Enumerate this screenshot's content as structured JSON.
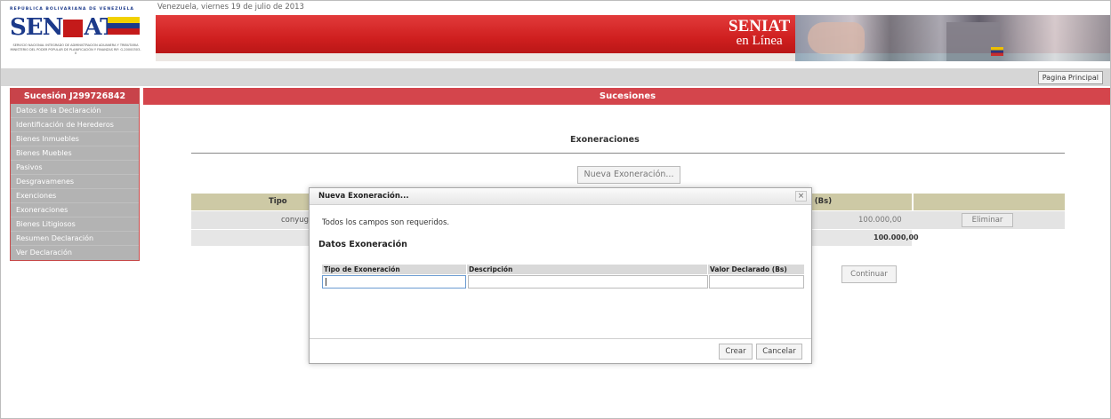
{
  "header": {
    "logo_republica": "REPÚBLICA BOLIVARIANA DE VENEZUELA",
    "logo_left": "SEN",
    "logo_right": "AT",
    "logo_sub": "SERVICIO NACIONAL INTEGRADO DE ADMINISTRACIÓN ADUANERA Y TRIBUTARIA MINISTERIO DEL PODER POPULAR DE PLANIFICACIÓN Y FINANZAS RIF: G-20000303-0",
    "date": "Venezuela, viernes 19 de julio de 2013",
    "brand_line1": "SENIAT",
    "brand_line2": "en Línea",
    "pagina_principal": "Pagina Principal"
  },
  "sidebar": {
    "title": "Sucesión J299726842",
    "items": [
      "Datos de la Declaración",
      "Identificación de Herederos",
      "Bienes Inmuebles",
      "Bienes Muebles",
      "Pasivos",
      "Desgravamenes",
      "Exenciones",
      "Exoneraciones",
      "Bienes Litigiosos",
      "Resumen Declaración",
      "Ver Declaración"
    ]
  },
  "main": {
    "header": "Sucesiones",
    "section_title": "Exoneraciones",
    "nueva_button": "Nueva Exoneración...",
    "table": {
      "col_tipo_partial": "Tipo",
      "col_bs_partial": "o (Bs)",
      "row_tipo_partial": "conyug",
      "row_valor": "100.000,00",
      "eliminar": "Eliminar",
      "total": "100.000,00"
    },
    "continuar": "Continuar"
  },
  "dialog": {
    "title": "Nueva Exoneración...",
    "close_glyph": "×",
    "required_text": "Todos los campos son requeridos.",
    "section": "Datos Exoneración",
    "columns": [
      "Tipo de Exoneración",
      "Descripción",
      "Valor Declarado (Bs)"
    ],
    "values": {
      "tipo": "",
      "descripcion": "",
      "valor": ""
    },
    "crear": "Crear",
    "cancelar": "Cancelar"
  },
  "colors": {
    "brand_red": "#d4454c",
    "sidebar_item": "#b3b3b3",
    "table_head": "#cdc9a5"
  }
}
